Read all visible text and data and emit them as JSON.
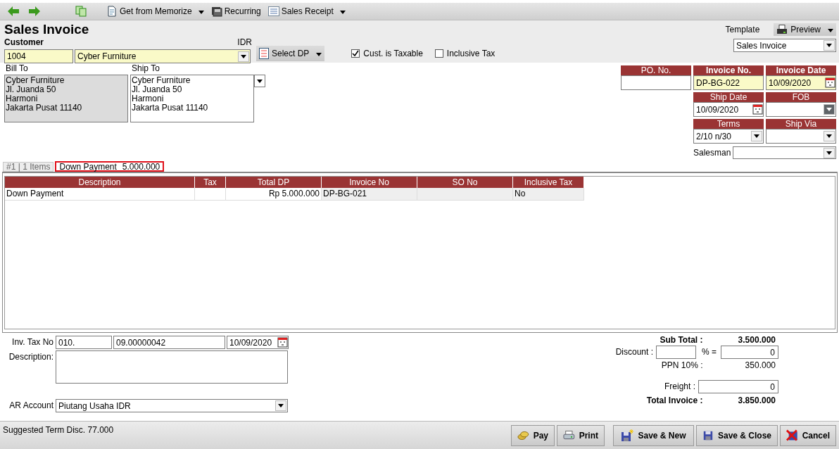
{
  "toolbar": [
    {
      "label": "Get from Memorize",
      "dropdown": true
    },
    {
      "label": "Recurring",
      "dropdown": false
    },
    {
      "label": "Sales Receipt",
      "dropdown": true
    }
  ],
  "title": "Sales Invoice",
  "customer": {
    "label": "Customer",
    "id": "1004",
    "name": "Cyber Furniture",
    "currency": "IDR"
  },
  "select_dp": "Select DP",
  "options": [
    {
      "label": "Cust. is Taxable",
      "checked": true
    },
    {
      "label": "Inclusive Tax",
      "checked": false
    }
  ],
  "template": {
    "label": "Template",
    "value": "Sales Invoice",
    "preview": "Preview"
  },
  "bill_to": {
    "label": "Bill To",
    "lines": [
      "Cyber Furniture",
      "Jl. Juanda 50",
      "Harmoni",
      "Jakarta Pusat 11140"
    ]
  },
  "ship_to": {
    "label": "Ship To",
    "lines": [
      "Cyber Furniture",
      "Jl. Juanda 50",
      "Harmoni",
      "Jakarta Pusat 11140"
    ]
  },
  "header_fields": [
    {
      "label": "PO. No.",
      "kind": "text",
      "required": false
    },
    {
      "label": "Invoice No.",
      "kind": "text",
      "required": true,
      "value": "DP-BG-022"
    },
    {
      "label": "Invoice Date",
      "kind": "date",
      "required": true,
      "value": "10/09/2020"
    },
    {
      "label": "Ship Date",
      "kind": "date",
      "required": false,
      "value": "10/09/2020"
    },
    {
      "label": "FOB",
      "kind": "select",
      "required": false,
      "focused": true
    },
    {
      "label": "Terms",
      "kind": "select",
      "required": false,
      "value": "2/10 n/30"
    },
    {
      "label": "Ship Via",
      "kind": "select",
      "required": false
    }
  ],
  "salesman": {
    "label": "Salesman"
  },
  "tabs": [
    {
      "label": "#1 | 1 Items",
      "selected": false
    },
    {
      "label": "Down Payment",
      "amount": "5.000.000",
      "selected": true
    }
  ],
  "table": {
    "columns": [
      {
        "label": "Description",
        "readonly": false
      },
      {
        "label": "Tax",
        "readonly": false
      },
      {
        "label": "Total DP",
        "readonly": false
      },
      {
        "label": "Invoice No",
        "readonly": true
      },
      {
        "label": "SO No",
        "readonly": true
      },
      {
        "label": "Inclusive Tax",
        "readonly": true
      }
    ],
    "rows": [
      {
        "cells": [
          "Down Payment",
          null,
          "Rp 5.000.000",
          "DP-BG-021",
          null,
          "No"
        ]
      }
    ]
  },
  "inv_tax": {
    "label": "Inv. Tax No",
    "prefix": "010.",
    "number": "09.00000042",
    "date": "10/09/2020"
  },
  "description": {
    "label": "Description:"
  },
  "ar_account": {
    "label": "AR Account",
    "value": "Piutang Usaha IDR"
  },
  "totals": {
    "subtotal": {
      "label": "Sub Total :",
      "value": "3.500.000"
    },
    "discount": {
      "label": "Discount :",
      "percent_label": "% =",
      "value": "0"
    },
    "tax": {
      "label": "PPN 10% :",
      "value": "350.000"
    },
    "freight": {
      "label": "Freight :",
      "value": "0"
    },
    "total": {
      "label": "Total Invoice :",
      "value": "3.850.000"
    }
  },
  "status": "Suggested Term Disc. 77.000",
  "buttons": [
    {
      "label": "Pay"
    },
    {
      "label": "Print"
    },
    {
      "label": "Save & New"
    },
    {
      "label": "Save & Close"
    },
    {
      "label": "Cancel"
    }
  ]
}
